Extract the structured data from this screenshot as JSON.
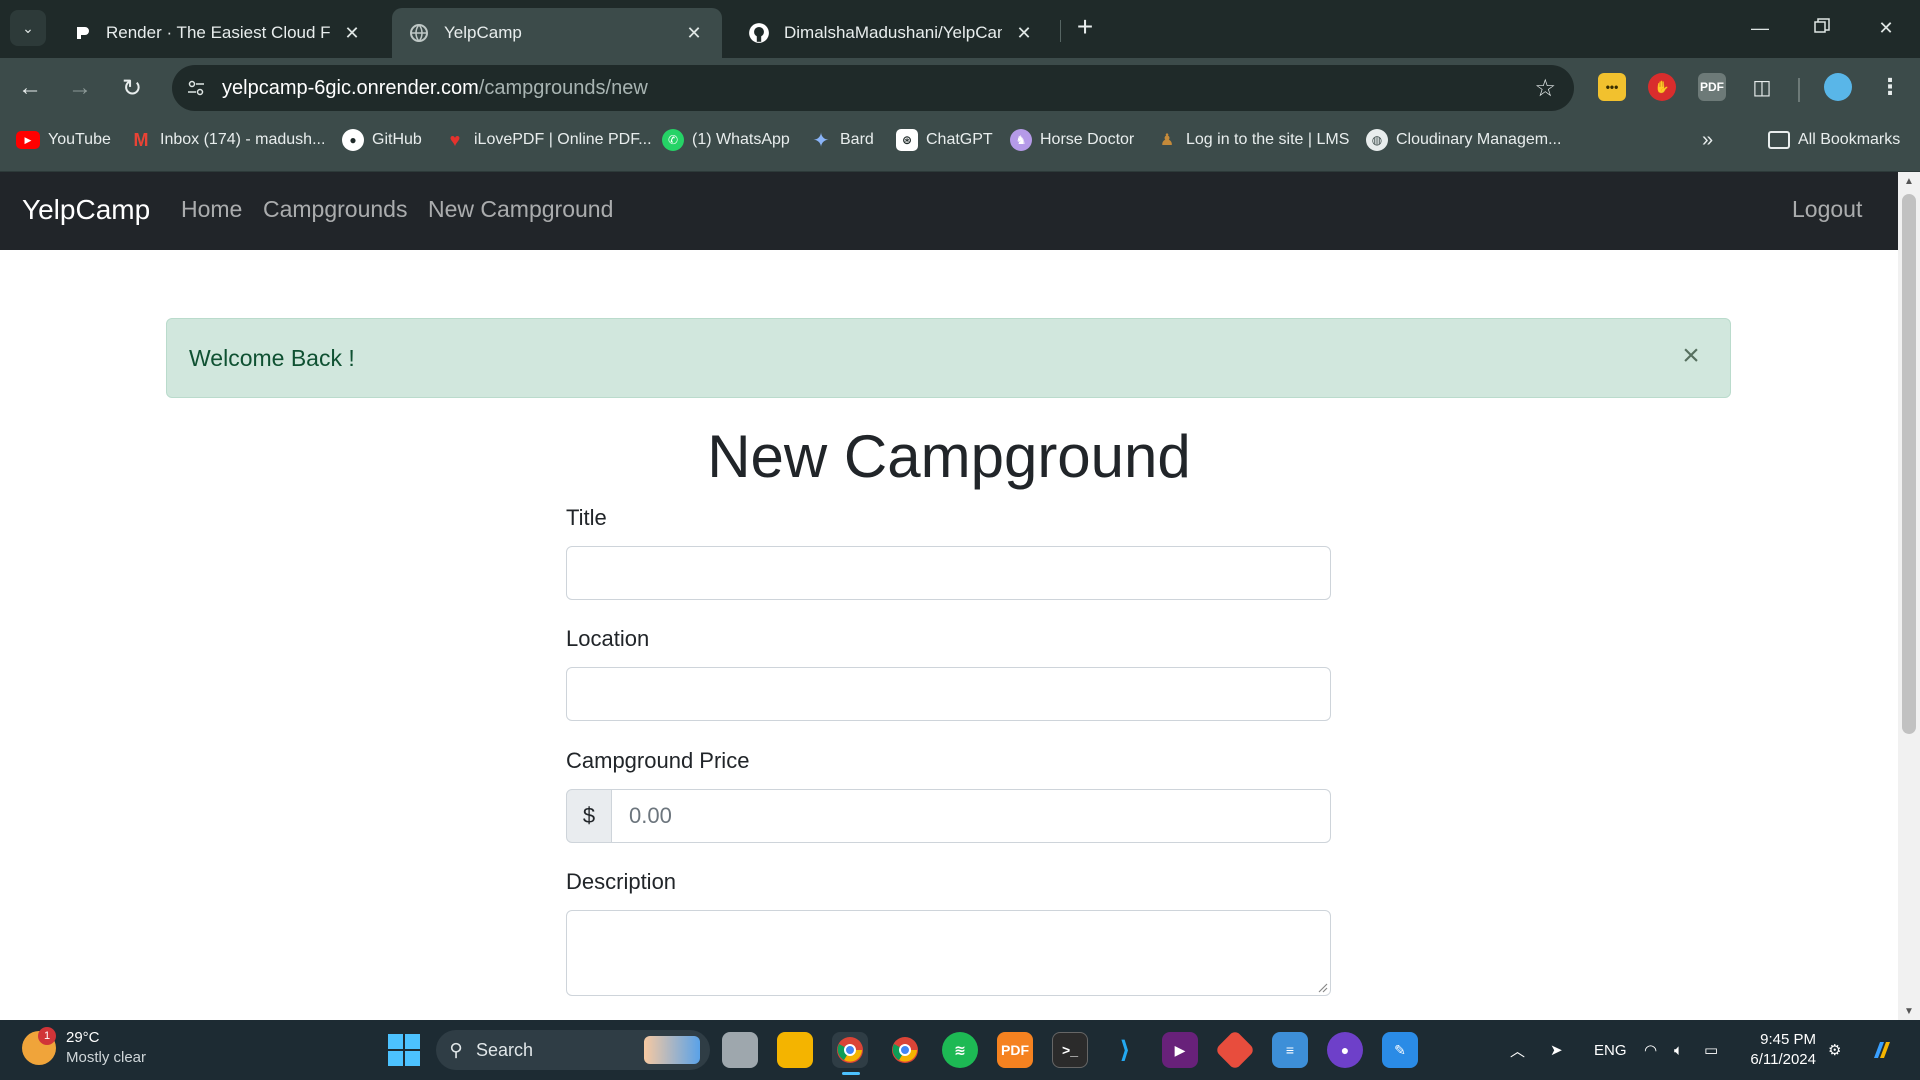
{
  "browser": {
    "tabs": [
      {
        "title": "Render · The Easiest Cloud For All Y",
        "active": false
      },
      {
        "title": "YelpCamp",
        "active": true
      },
      {
        "title": "DimalshaMadushani/YelpCamp: A",
        "active": false
      }
    ],
    "url_host": "yelpcamp-6gic.onrender.com",
    "url_path": "/campgrounds/new",
    "bookmarks": [
      {
        "label": "YouTube",
        "icon": "youtube-icon"
      },
      {
        "label": "Inbox (174) - madush...",
        "icon": "gmail-icon"
      },
      {
        "label": "GitHub",
        "icon": "github-icon"
      },
      {
        "label": "iLovePDF | Online PDF...",
        "icon": "ilovepdf-icon"
      },
      {
        "label": "(1) WhatsApp",
        "icon": "whatsapp-icon"
      },
      {
        "label": "Bard",
        "icon": "bard-icon"
      },
      {
        "label": "ChatGPT",
        "icon": "chatgpt-icon"
      },
      {
        "label": "Horse Doctor",
        "icon": "horse-doctor-icon"
      },
      {
        "label": "Log in to the site | LMS",
        "icon": "lms-icon"
      },
      {
        "label": "Cloudinary Managem...",
        "icon": "globe-icon"
      }
    ],
    "all_bookmarks": "All Bookmarks"
  },
  "site": {
    "brand": "YelpCamp",
    "nav": {
      "home": "Home",
      "campgrounds": "Campgrounds",
      "new": "New Campground",
      "logout": "Logout"
    },
    "alert": {
      "message": "Welcome Back !",
      "close": "×"
    },
    "title": "New Campground",
    "form": {
      "title_label": "Title",
      "location_label": "Location",
      "price_label": "Campground Price",
      "currency": "$",
      "price_placeholder": "0.00",
      "description_label": "Description"
    }
  },
  "taskbar": {
    "temperature": "29°C",
    "condition": "Mostly clear",
    "weather_badge": "1",
    "search": "Search",
    "language": "ENG",
    "time": "9:45 PM",
    "date": "6/11/2024"
  },
  "colors": {
    "navbar_bg": "#212529",
    "alert_bg": "#d1e7dd",
    "alert_text": "#0f5132",
    "browser_chrome": "#3c4b4a"
  }
}
